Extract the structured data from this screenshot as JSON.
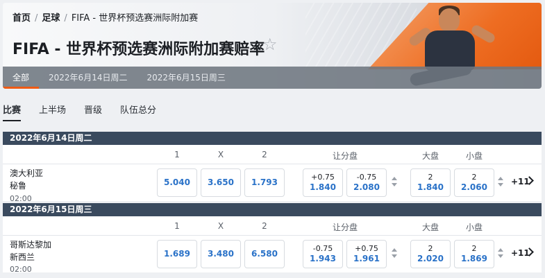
{
  "breadcrumb": {
    "home": "首页",
    "sport": "足球",
    "current": "FIFA - 世界杯预选赛洲际附加赛"
  },
  "title": "FIFA - 世界杯预选赛洲际附加赛赔率",
  "date_tabs": [
    "全部",
    "2022年6月14日周二",
    "2022年6月15日周三"
  ],
  "market_tabs": [
    "比赛",
    "上半场",
    "晋级",
    "队伍总分"
  ],
  "columns": {
    "c1": "1",
    "cx": "X",
    "c2": "2",
    "handicap": "让分盘",
    "over": "大盘",
    "under": "小盘"
  },
  "sections": [
    {
      "date": "2022年6月14日周二",
      "match": {
        "home": "澳大利亚",
        "away": "秘鲁",
        "time": "02:00",
        "odds": [
          "5.040",
          "3.650",
          "1.793"
        ],
        "handicap": [
          {
            "line": "+0.75",
            "price": "1.840"
          },
          {
            "line": "-0.75",
            "price": "2.080"
          }
        ],
        "total": [
          {
            "line": "2",
            "price": "1.840"
          },
          {
            "line": "2",
            "price": "2.060"
          }
        ],
        "more": "+11"
      }
    },
    {
      "date": "2022年6月15日周三",
      "match": {
        "home": "哥斯达黎加",
        "away": "新西兰",
        "time": "02:00",
        "odds": [
          "1.689",
          "3.480",
          "6.580"
        ],
        "handicap": [
          {
            "line": "-0.75",
            "price": "1.943"
          },
          {
            "line": "+0.75",
            "price": "1.961"
          }
        ],
        "total": [
          {
            "line": "2",
            "price": "2.020"
          },
          {
            "line": "2",
            "price": "1.869"
          }
        ],
        "more": "+11"
      }
    }
  ],
  "colors": {
    "accent": "#f05a14",
    "odds": "#2a72c8",
    "section_header": "#3a4a5e"
  },
  "icons": {
    "favorite": "star-icon",
    "expand": "chevron-right-icon",
    "sort": "sort-arrows-icon"
  }
}
